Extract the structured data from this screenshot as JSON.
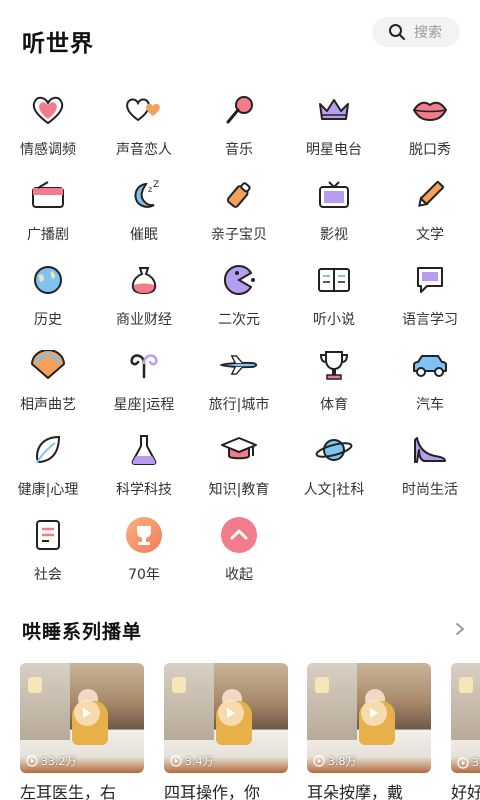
{
  "header": {
    "title": "听世界",
    "search_label": "搜索"
  },
  "categories": [
    {
      "label": "情感调频",
      "icon": "heart-icon"
    },
    {
      "label": "声音恋人",
      "icon": "double-heart-icon"
    },
    {
      "label": "音乐",
      "icon": "microphone-icon"
    },
    {
      "label": "明星电台",
      "icon": "crown-icon"
    },
    {
      "label": "脱口秀",
      "icon": "lips-icon"
    },
    {
      "label": "广播剧",
      "icon": "radio-icon"
    },
    {
      "label": "催眠",
      "icon": "moon-icon"
    },
    {
      "label": "亲子宝贝",
      "icon": "baby-bottle-icon"
    },
    {
      "label": "影视",
      "icon": "tv-icon"
    },
    {
      "label": "文学",
      "icon": "pen-icon"
    },
    {
      "label": "历史",
      "icon": "globe-icon"
    },
    {
      "label": "商业财经",
      "icon": "money-bag-icon"
    },
    {
      "label": "二次元",
      "icon": "pacman-icon"
    },
    {
      "label": "听小说",
      "icon": "book-icon"
    },
    {
      "label": "语言学习",
      "icon": "chat-bubble-icon"
    },
    {
      "label": "相声曲艺",
      "icon": "fan-icon"
    },
    {
      "label": "星座|运程",
      "icon": "aries-icon"
    },
    {
      "label": "旅行|城市",
      "icon": "airplane-icon"
    },
    {
      "label": "体育",
      "icon": "trophy-icon"
    },
    {
      "label": "汽车",
      "icon": "car-icon"
    },
    {
      "label": "健康|心理",
      "icon": "leaf-icon"
    },
    {
      "label": "科学科技",
      "icon": "flask-icon"
    },
    {
      "label": "知识|教育",
      "icon": "graduation-cap-icon"
    },
    {
      "label": "人文|社科",
      "icon": "planet-icon"
    },
    {
      "label": "时尚生活",
      "icon": "high-heel-icon"
    },
    {
      "label": "社会",
      "icon": "document-icon"
    },
    {
      "label": "70年",
      "icon": "70-years-badge-icon"
    },
    {
      "label": "收起",
      "icon": "collapse-up-icon"
    }
  ],
  "playlist_section": {
    "title": "哄睡系列播单",
    "cards": [
      {
        "title": "左耳医生，右",
        "plays": "33.2万"
      },
      {
        "title": "四耳操作，你",
        "plays": "3.4万"
      },
      {
        "title": "耳朵按摩，戴",
        "plays": "3.8万"
      },
      {
        "title": "好好",
        "plays": "3"
      }
    ]
  },
  "colors": {
    "accent_pink": "#f27b8c",
    "accent_purple": "#b79cf0",
    "accent_blue": "#7ec3f2",
    "outline": "#222222"
  }
}
